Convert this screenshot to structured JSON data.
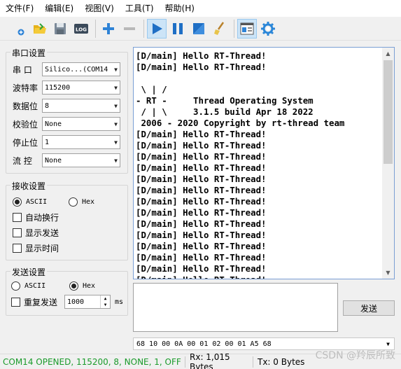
{
  "menu": [
    "文件(F)",
    "编辑(E)",
    "视图(V)",
    "工具(T)",
    "帮助(H)"
  ],
  "toolbar": {
    "icons": [
      "new-icon",
      "open-icon",
      "save-icon",
      "log-icon",
      "add-icon",
      "remove-icon",
      "play-icon",
      "pause-icon",
      "stop-icon",
      "clear-icon",
      "layout-icon",
      "gear-icon"
    ],
    "log_label": "LOG",
    "colors": {
      "play": "#1f6fc5",
      "add": "#2f83d6",
      "gear": "#2a86d8"
    }
  },
  "serial": {
    "title": "串口设置",
    "fields": [
      {
        "label": "串  口",
        "value": "Silico...(COM14"
      },
      {
        "label": "波特率",
        "value": "115200"
      },
      {
        "label": "数据位",
        "value": "8"
      },
      {
        "label": "校验位",
        "value": "None"
      },
      {
        "label": "停止位",
        "value": "1"
      },
      {
        "label": "流  控",
        "value": "None"
      }
    ]
  },
  "receive": {
    "title": "接收设置",
    "ascii_label": "ASCII",
    "hex_label": "Hex",
    "mode": "ASCII",
    "auto_wrap": "自动换行",
    "show_send": "显示发送",
    "show_time": "显示时间"
  },
  "send": {
    "title": "发送设置",
    "ascii_label": "ASCII",
    "hex_label": "Hex",
    "mode": "Hex",
    "repeat_label": "重复发送",
    "interval": "1000",
    "unit": "ms",
    "button": "发送",
    "hex_history": "68 10 00 0A 00 01 02 00 01 A5 68"
  },
  "output_lines": [
    "[D/main] Hello RT-Thread!",
    "[D/main] Hello RT-Thread!",
    "",
    " \\ | /",
    "- RT -     Thread Operating System",
    " / | \\     3.1.5 build Apr 18 2022",
    " 2006 - 2020 Copyright by rt-thread team",
    "[D/main] Hello RT-Thread!",
    "[D/main] Hello RT-Thread!",
    "[D/main] Hello RT-Thread!",
    "[D/main] Hello RT-Thread!",
    "[D/main] Hello RT-Thread!",
    "[D/main] Hello RT-Thread!",
    "[D/main] Hello RT-Thread!",
    "[D/main] Hello RT-Thread!",
    "[D/main] Hello RT-Thread!",
    "[D/main] Hello RT-Thread!",
    "[D/main] Hello RT-Thread!",
    "[D/main] Hello RT-Thread!",
    "[D/main] Hello RT-Thread!",
    "[D/main] Hello RT-Thread!"
  ],
  "status": {
    "connection": "COM14 OPENED, 115200, 8, NONE, 1, OFF",
    "rx": "Rx: 1,015 Bytes",
    "tx": "Tx: 0 Bytes",
    "watermark": "CSDN @羚辰所致",
    "connection_color": "#1a9b2b"
  }
}
